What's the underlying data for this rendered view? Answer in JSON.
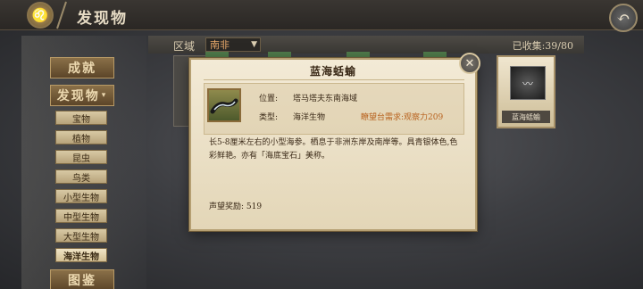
{
  "header": {
    "title": "发现物",
    "logo_icon": "lion-emblem-icon",
    "back_icon": "back-arrow-icon"
  },
  "menu": {
    "main_items": [
      "成就",
      "发现物",
      "图鉴"
    ],
    "sub_items": [
      "宝物",
      "植物",
      "昆虫",
      "鸟类",
      "小型生物",
      "中型生物",
      "大型生物",
      "海洋生物"
    ],
    "active_sub": "海洋生物"
  },
  "filter": {
    "region_label": "区域",
    "region_value": "南非",
    "collected": "已收集:39/80"
  },
  "card": {
    "label": "蓝海蛞蝓"
  },
  "dialog": {
    "title": "蓝海蛞蝓",
    "location_key": "位置:",
    "location_value": "塔马塔夫东南海域",
    "type_key": "类型:",
    "type_value": "海洋生物",
    "requirement": "瞭望台需求:观察力209",
    "description": "长5-8厘米左右的小型海参。栖息于非洲东岸及南岸等。具青银体色,色彩鲜艳。亦有「海底宝石」美称。",
    "reward": "声望奖励: 519"
  },
  "colors": {
    "accent_orange": "#b8621e",
    "parchment": "#f3ead6"
  }
}
